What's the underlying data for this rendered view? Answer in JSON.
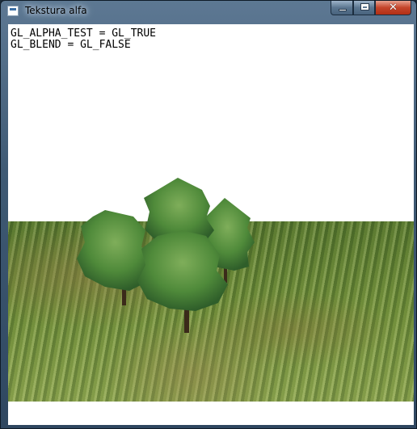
{
  "window": {
    "title": "Tekstura alfa",
    "icon": "app-window-icon",
    "controls": {
      "minimize_icon": "minimize-icon",
      "maximize_icon": "maximize-icon",
      "close_icon": "close-icon",
      "close_glyph": "✕"
    }
  },
  "status": {
    "line1": "GL_ALPHA_TEST = GL_TRUE",
    "line2": "GL_BLEND = GL_FALSE"
  },
  "scene": {
    "sky_color": "#ffffff",
    "grass_color": "#6d8a3a",
    "tree_color": "#5c8a3c",
    "trunk_color": "#3b2a1a"
  }
}
